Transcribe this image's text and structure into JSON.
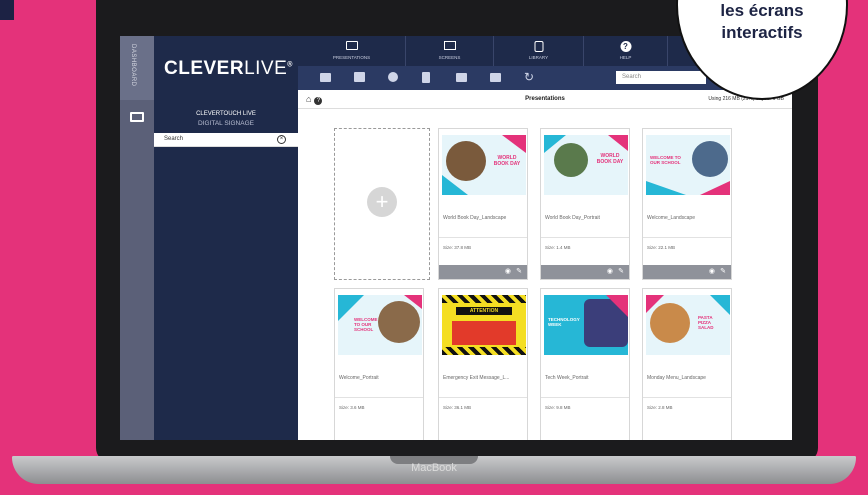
{
  "device": {
    "label": "MacBook"
  },
  "bubble": {
    "line1": "les écrans",
    "line2": "interactifs"
  },
  "rail": {
    "label": "DASHBOARD"
  },
  "sidebar": {
    "logo_bold": "CLEVER",
    "logo_light": "LIVE",
    "logo_mark": "®",
    "title": "CLEVERTOUCH LIVE",
    "subtitle": "DIGITAL SIGNAGE",
    "search_label": "Search"
  },
  "topnav": {
    "items": [
      {
        "label": "PRESENTATIONS",
        "icon": "presentation-icon"
      },
      {
        "label": "SCREENS",
        "icon": "monitor-icon"
      },
      {
        "label": "LIBRARY",
        "icon": "library-icon"
      },
      {
        "label": "HELP",
        "icon": "help-icon"
      }
    ]
  },
  "toolbar": {
    "search_placeholder": "Search"
  },
  "content": {
    "title": "Presentations",
    "usage": "Using 216 MB (21%) of your 1 GB"
  },
  "cards": [
    {
      "name": "World Book Day_Landscape",
      "size": "Size: 37.8 MB"
    },
    {
      "name": "World Book Day_Portrait",
      "size": "Size: 1.4 MB"
    },
    {
      "name": "Welcome_Landscape",
      "size": "Size: 22.1 MB"
    },
    {
      "name": "Welcome_Portrait",
      "size": "Size: 3.6 MB"
    },
    {
      "name": "Emergency Exit Message_L...",
      "size": "Size: 36.1 MB"
    },
    {
      "name": "Tech Week_Portrait",
      "size": "Size: 9.8 MB"
    },
    {
      "name": "Monday Menu_Landscape",
      "size": "Size: 2.8 MB"
    }
  ],
  "thumb_text": {
    "wbd": "WORLD BOOK DAY",
    "welcome": "WELCOME TO OUR SCHOOL",
    "attention": "ATTENTION",
    "tech": "TECHNOLOGY WEEK",
    "menu": "PASTA PIZZA SALAD"
  },
  "colors": {
    "brand_navy": "#1e2a4a",
    "accent_pink": "#e4327a",
    "accent_cyan": "#26b7d6"
  }
}
